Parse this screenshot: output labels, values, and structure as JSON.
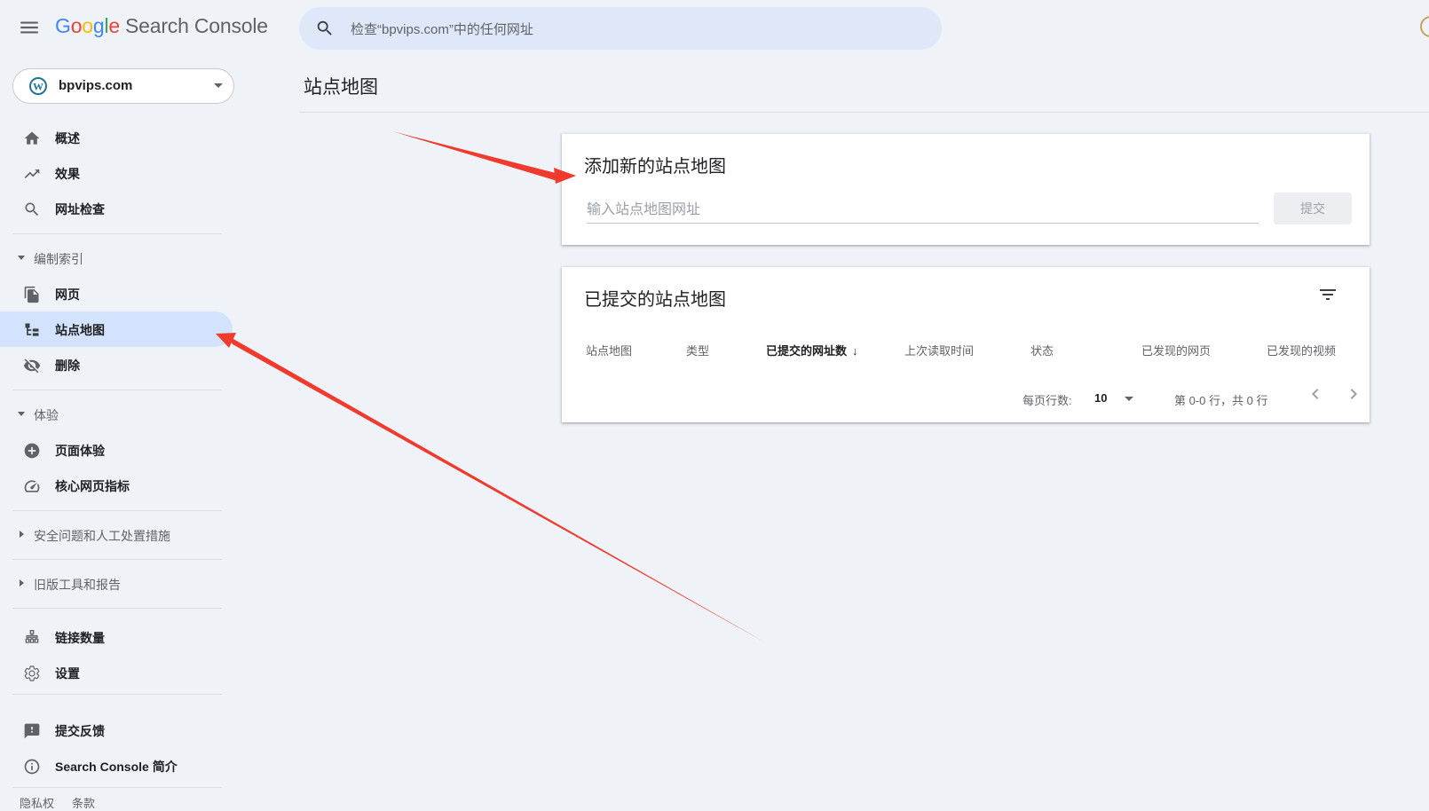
{
  "header": {
    "logo_google": "Google",
    "product_name": "Search Console",
    "search_placeholder": "检查“bpvips.com”中的任何网址"
  },
  "property": {
    "name": "bpvips.com",
    "icon": "wordpress-icon"
  },
  "sidebar": {
    "items_top": [
      {
        "label": "概述",
        "icon": "home-icon"
      },
      {
        "label": "效果",
        "icon": "trending-up-icon"
      },
      {
        "label": "网址检查",
        "icon": "search-icon"
      }
    ],
    "section_index": {
      "title": "编制索引",
      "items": [
        {
          "label": "网页",
          "icon": "pages-icon"
        },
        {
          "label": "站点地图",
          "icon": "sitemap-icon",
          "active": true
        },
        {
          "label": "删除",
          "icon": "visibility-off-icon"
        }
      ]
    },
    "section_experience": {
      "title": "体验",
      "items": [
        {
          "label": "页面体验",
          "icon": "add-circle-icon"
        },
        {
          "label": "核心网页指标",
          "icon": "speed-gauge-icon"
        }
      ]
    },
    "section_security": {
      "title": "安全问题和人工处置措施"
    },
    "section_legacy": {
      "title": "旧版工具和报告"
    },
    "items_bottom": [
      {
        "label": "链接数量",
        "icon": "links-icon"
      },
      {
        "label": "设置",
        "icon": "settings-icon"
      }
    ],
    "items_footer": [
      {
        "label": "提交反馈",
        "icon": "feedback-icon"
      },
      {
        "label": "Search Console 简介",
        "icon": "info-icon"
      }
    ],
    "footer_links": [
      "隐私权",
      "条款"
    ]
  },
  "main": {
    "page_title": "站点地图",
    "add_card": {
      "title": "添加新的站点地图",
      "input_placeholder": "输入站点地图网址",
      "submit_label": "提交"
    },
    "submitted_card": {
      "title": "已提交的站点地图",
      "columns": [
        "站点地图",
        "类型",
        "已提交的网址数",
        "上次读取时间",
        "状态",
        "已发现的网页",
        "已发现的视频"
      ],
      "sorted_column_arrow": "↓",
      "rows_per_page_label": "每页行数:",
      "rows_per_page_value": "10",
      "range_text": "第 0-0 行，共 0 行"
    }
  },
  "colors": {
    "accent": "#d3e3fd",
    "annotation_arrow": "#f03a2e",
    "background": "#eff2f7"
  }
}
